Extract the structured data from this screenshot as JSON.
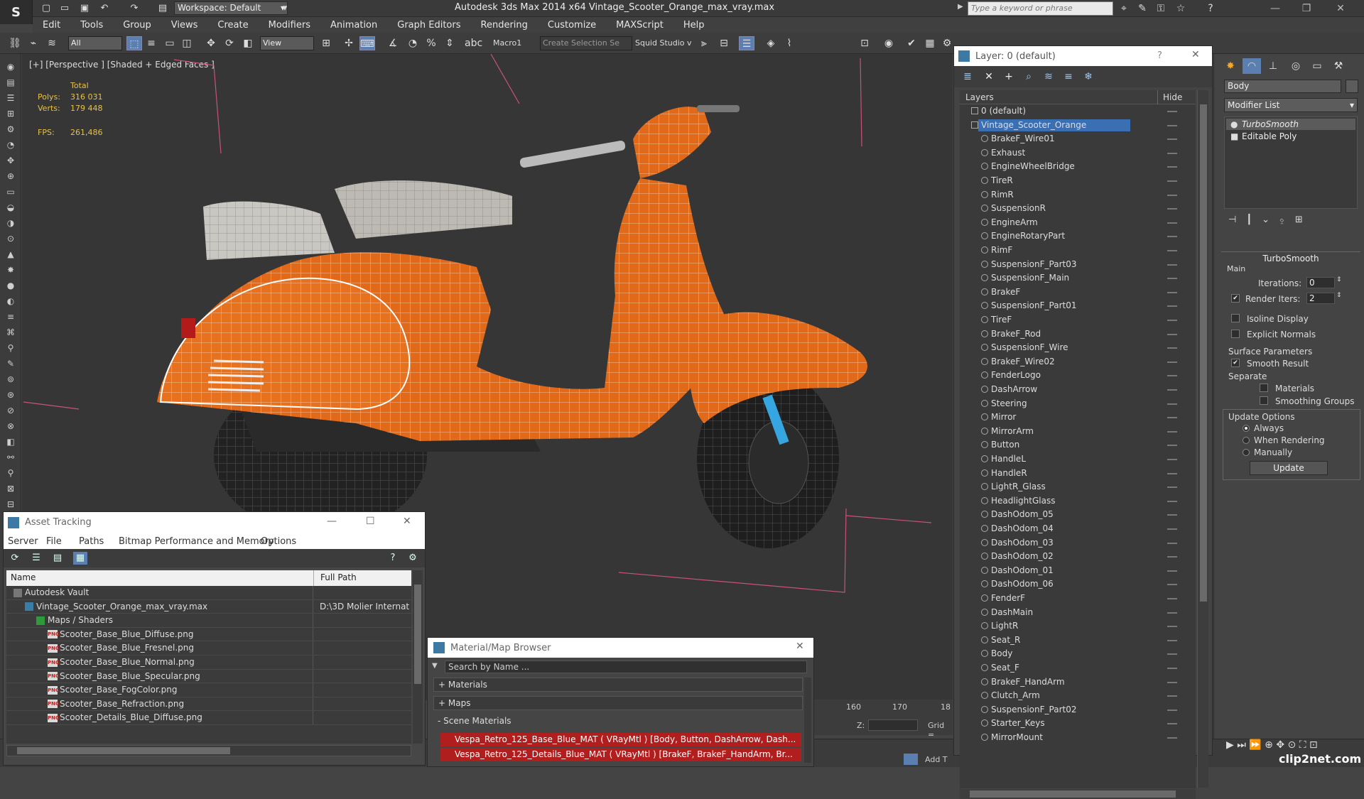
{
  "titlebar": {
    "workspace": "Workspace: Default",
    "title": "Autodesk 3ds Max  2014 x64     Vintage_Scooter_Orange_max_vray.max",
    "search_placeholder": "Type a keyword or phrase"
  },
  "menu": [
    "Edit",
    "Tools",
    "Group",
    "Views",
    "Create",
    "Modifiers",
    "Animation",
    "Graph Editors",
    "Rendering",
    "Customize",
    "MAXScript",
    "Help"
  ],
  "toolbar": {
    "filter": "All",
    "ref_coord": "View",
    "macro": "Macro1",
    "selection_set": "Create Selection Se",
    "studio": "Squid Studio v"
  },
  "viewport": {
    "label": "[+] [Perspective ] [Shaded + Edged Faces ]",
    "stats": {
      "total_label": "Total",
      "polys_label": "Polys:",
      "polys": "316 031",
      "verts_label": "Verts:",
      "verts": "179 448",
      "fps_label": "FPS:",
      "fps": "261,486"
    },
    "colors": {
      "body": "#e06a1a",
      "seat": "#c9c7c2",
      "tire": "#1e1e1e",
      "accent": "#35a6e0"
    }
  },
  "asset_tracking": {
    "title": "Asset Tracking",
    "menu": [
      "Server",
      "File",
      "Paths",
      "Bitmap Performance and Memory",
      "Options"
    ],
    "columns": [
      "Name",
      "Full Path"
    ],
    "rows": [
      {
        "name": "Autodesk Vault",
        "path": "",
        "indent": 0,
        "icon": "vault"
      },
      {
        "name": "Vintage_Scooter_Orange_max_vray.max",
        "path": "D:\\3D Molier Internat",
        "indent": 1,
        "icon": "max"
      },
      {
        "name": "Maps / Shaders",
        "path": "",
        "indent": 2,
        "icon": "folder"
      },
      {
        "name": "Scooter_Base_Blue_Diffuse.png",
        "path": "",
        "indent": 3,
        "icon": "png"
      },
      {
        "name": "Scooter_Base_Blue_Fresnel.png",
        "path": "",
        "indent": 3,
        "icon": "png"
      },
      {
        "name": "Scooter_Base_Blue_Normal.png",
        "path": "",
        "indent": 3,
        "icon": "png"
      },
      {
        "name": "Scooter_Base_Blue_Specular.png",
        "path": "",
        "indent": 3,
        "icon": "png"
      },
      {
        "name": "Scooter_Base_FogColor.png",
        "path": "",
        "indent": 3,
        "icon": "png"
      },
      {
        "name": "Scooter_Base_Refraction.png",
        "path": "",
        "indent": 3,
        "icon": "png"
      },
      {
        "name": "Scooter_Details_Blue_Diffuse.png",
        "path": "",
        "indent": 3,
        "icon": "png"
      }
    ],
    "png_badge": "PNG"
  },
  "material_browser": {
    "title": "Material/Map Browser",
    "search_placeholder": "Search by Name ...",
    "sections": [
      "+ Materials",
      "+ Maps",
      "- Scene Materials"
    ],
    "items": [
      "Vespa_Retro_125_Base_Blue_MAT ( VRayMtl ) [Body, Button, DashArrow, Dash...",
      "Vespa_Retro_125_Details_Blue_MAT ( VRayMtl ) [BrakeF, BrakeF_HandArm, Br..."
    ]
  },
  "timeline": {
    "ticks": [
      "160",
      "170",
      "18"
    ],
    "z_label": "Z:",
    "grid_label": "Grid =",
    "addtime": "Add T"
  },
  "layers": {
    "title": "Layer: 0 (default)",
    "help": "?",
    "col_layers": "Layers",
    "col_hide": "Hide",
    "default_layer": "0 (default)",
    "selected_layer": "Vintage_Scooter_Orange",
    "objects": [
      "BrakeF_Wire01",
      "Exhaust",
      "EngineWheelBridge",
      "TireR",
      "RimR",
      "SuspensionR",
      "EngineArm",
      "EngineRotaryPart",
      "RimF",
      "SuspensionF_Part03",
      "SuspensionF_Main",
      "BrakeF",
      "SuspensionF_Part01",
      "TireF",
      "BrakeF_Rod",
      "SuspensionF_Wire",
      "BrakeF_Wire02",
      "FenderLogo",
      "DashArrow",
      "Steering",
      "Mirror",
      "MirrorArm",
      "Button",
      "HandleL",
      "HandleR",
      "LightR_Glass",
      "HeadlightGlass",
      "DashOdom_05",
      "DashOdom_04",
      "DashOdom_03",
      "DashOdom_02",
      "DashOdom_01",
      "DashOdom_06",
      "FenderF",
      "DashMain",
      "LightR",
      "Seat_R",
      "Body",
      "Seat_F",
      "BrakeF_HandArm",
      "Clutch_Arm",
      "SuspensionF_Part02",
      "Starter_Keys",
      "MirrorMount"
    ]
  },
  "command_panel": {
    "object_name": "Body",
    "modifier_list": "Modifier List",
    "stack": [
      "TurboSmooth",
      "Editable Poly"
    ],
    "rollout": "TurboSmooth",
    "main": "Main",
    "iterations_label": "Iterations:",
    "iterations": "0",
    "render_iters_label": "Render Iters:",
    "render_iters": "2",
    "isoline": "Isoline Display",
    "explicit_normals": "Explicit Normals",
    "surface_params": "Surface Parameters",
    "smooth_result": "Smooth Result",
    "separate": "Separate",
    "materials": "Materials",
    "smoothing_groups": "Smoothing Groups",
    "update_options": "Update Options",
    "always": "Always",
    "when_rendering": "When Rendering",
    "manually": "Manually",
    "update": "Update"
  },
  "watermark": "clip2net.com"
}
